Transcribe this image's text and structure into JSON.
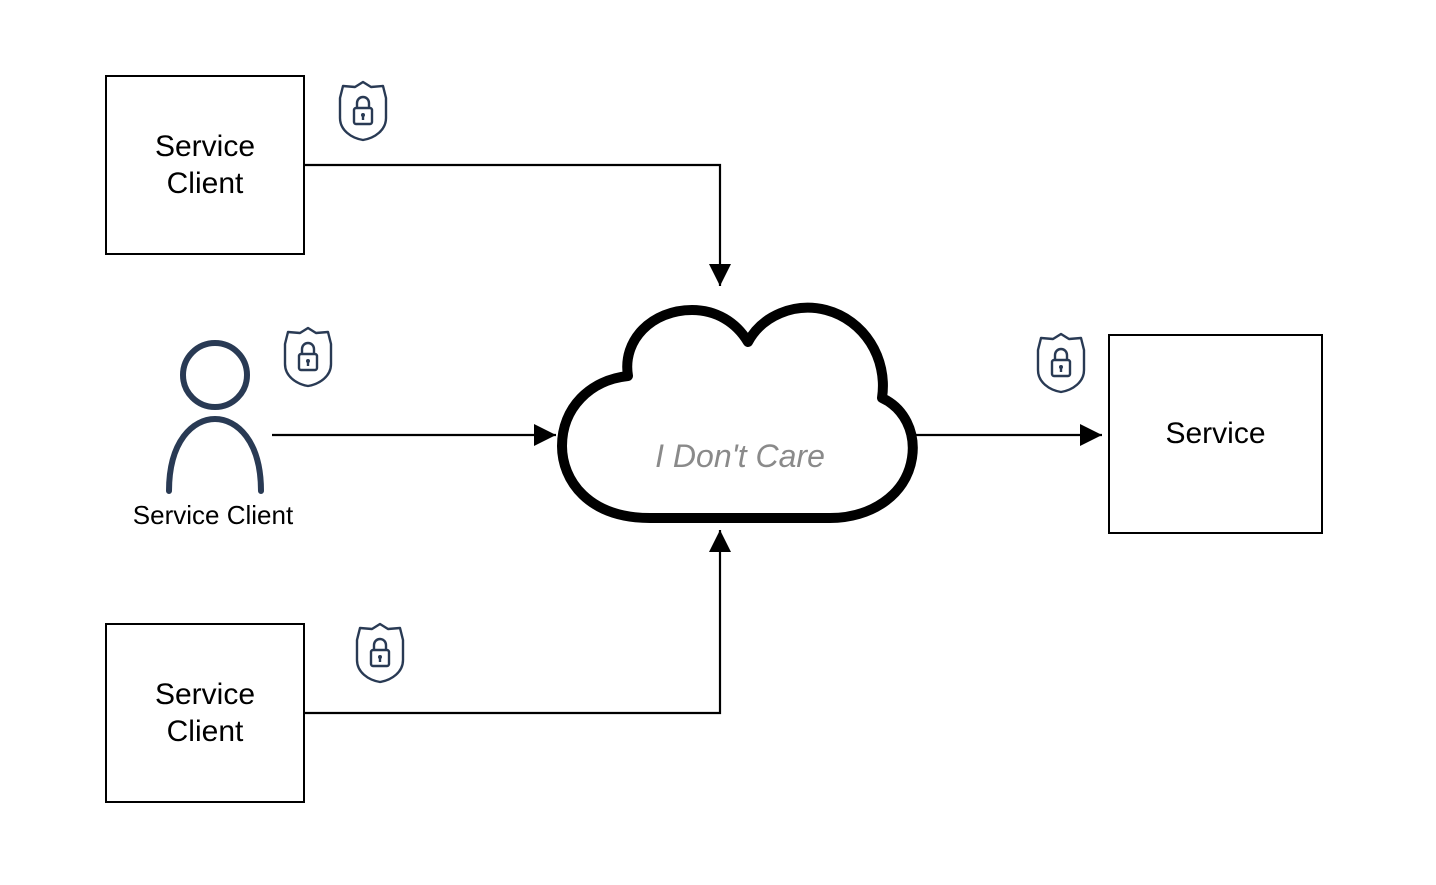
{
  "nodes": {
    "client_top": {
      "label": "Service\nClient"
    },
    "client_user": {
      "label": "Service Client"
    },
    "client_bottom": {
      "label": "Service\nClient"
    },
    "cloud": {
      "label": "I Don't Care"
    },
    "service": {
      "label": "Service"
    }
  },
  "colors": {
    "stroke_dark": "#293a54",
    "black": "#000000",
    "grey_text": "#8a8a8a"
  }
}
